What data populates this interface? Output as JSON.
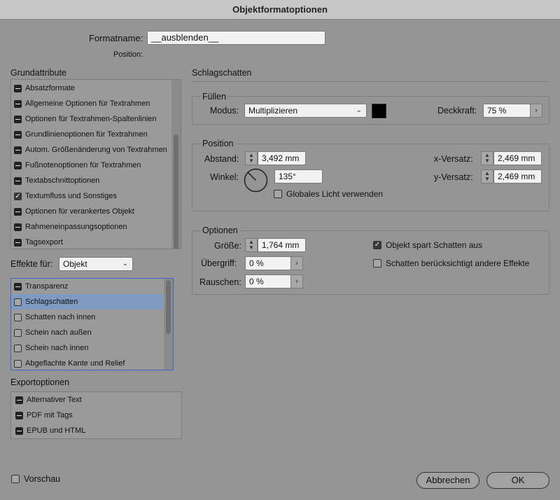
{
  "window": {
    "title": "Objektformatoptionen"
  },
  "format": {
    "name_label": "Formatname:",
    "name_value": "__ausblenden__",
    "position_label": "Position:"
  },
  "grundattribute": {
    "title": "Grundattribute",
    "items": [
      {
        "label": "Absatzformate",
        "state": "mixed"
      },
      {
        "label": "Allgemeine Optionen für Textrahmen",
        "state": "mixed"
      },
      {
        "label": "Optionen für Textrahmen-Spaltenlinien",
        "state": "mixed"
      },
      {
        "label": "Grundlinienoptionen für Textrahmen",
        "state": "mixed"
      },
      {
        "label": "Autom. Größenänderung von Textrahmen",
        "state": "mixed"
      },
      {
        "label": "Fußnotenoptionen für Textrahmen",
        "state": "mixed"
      },
      {
        "label": "Textabschnittoptionen",
        "state": "mixed"
      },
      {
        "label": "Textumfluss und Sonstiges",
        "state": "checked"
      },
      {
        "label": "Optionen für verankertes Objekt",
        "state": "mixed"
      },
      {
        "label": "Rahmeneinpassungsoptionen",
        "state": "mixed"
      },
      {
        "label": "Tagsexport",
        "state": "mixed"
      }
    ]
  },
  "effekte": {
    "label": "Effekte für:",
    "selected": "Objekt",
    "items": [
      {
        "label": "Transparenz",
        "state": "mixed"
      },
      {
        "label": "Schlagschatten",
        "state": "unchecked",
        "selected": true
      },
      {
        "label": "Schatten nach innen",
        "state": "unchecked"
      },
      {
        "label": "Schein nach außen",
        "state": "unchecked"
      },
      {
        "label": "Schein nach innen",
        "state": "unchecked"
      },
      {
        "label": "Abgeflachte Kante und Relief",
        "state": "unchecked"
      }
    ]
  },
  "export": {
    "title": "Exportoptionen",
    "items": [
      {
        "label": "Alternativer Text",
        "state": "mixed"
      },
      {
        "label": "PDF mit Tags",
        "state": "mixed"
      },
      {
        "label": "EPUB und HTML",
        "state": "mixed"
      }
    ]
  },
  "main": {
    "title": "Schlagschatten",
    "fuellen": {
      "title": "Füllen",
      "modus_label": "Modus:",
      "modus_value": "Multiplizieren",
      "color": "#000000",
      "deckkraft_label": "Deckkraft:",
      "deckkraft_value": "75 %"
    },
    "position": {
      "title": "Position",
      "abstand_label": "Abstand:",
      "abstand_value": "3,492 mm",
      "winkel_label": "Winkel:",
      "winkel_value": "135°",
      "global_light_label": "Globales Licht verwenden",
      "xversatz_label": "x-Versatz:",
      "xversatz_value": "2,469 mm",
      "yversatz_label": "y-Versatz:",
      "yversatz_value": "2,469 mm"
    },
    "optionen": {
      "title": "Optionen",
      "groesse_label": "Größe:",
      "groesse_value": "1,764 mm",
      "uebergriff_label": "Übergriff:",
      "uebergriff_value": "0 %",
      "rauschen_label": "Rauschen:",
      "rauschen_value": "0 %",
      "knockout_label": "Objekt spart Schatten aus",
      "honor_label": "Schatten berücksichtigt andere Effekte"
    }
  },
  "footer": {
    "vorschau_label": "Vorschau",
    "cancel_label": "Abbrechen",
    "ok_label": "OK"
  }
}
